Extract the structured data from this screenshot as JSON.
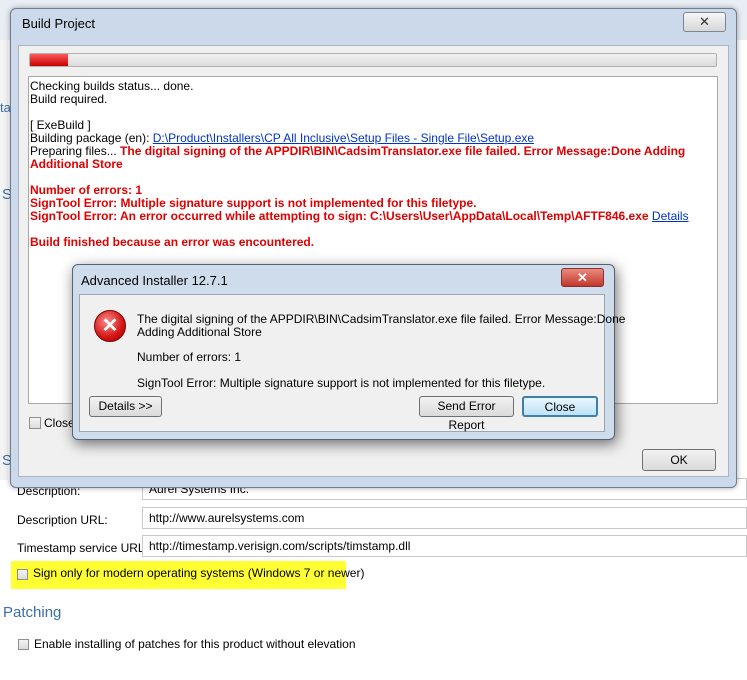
{
  "background_app": {
    "section_letters": [
      "ta",
      "S",
      "S"
    ],
    "description_label": "Description:",
    "description_value": "Aurel Systems Inc.",
    "description_url_label": "Description URL:",
    "description_url_value": "http://www.aurelsystems.com",
    "timestamp_label": "Timestamp service URL:",
    "timestamp_value": "http://timestamp.verisign.com/scripts/timstamp.dll",
    "sign_modern_label": "Sign only for modern operating systems (Windows 7 or newer)",
    "patching_title": "Patching",
    "patch_checkbox_label": "Enable installing of patches for this product without elevation"
  },
  "build_window": {
    "title": "Build Project",
    "close_glyph": "✕",
    "progress_fraction": 0.055,
    "log": {
      "line1": "Checking builds status... done.",
      "line2": "Build required.",
      "line3": "[ ExeBuild ]",
      "line4_prefix": "Building package (en): ",
      "line4_link": "D:\\Product\\Installers\\CP All Inclusive\\Setup Files - Single File\\Setup.exe",
      "line5_prefix": "Preparing files... ",
      "line5_error": "The digital signing of the APPDIR\\BIN\\CadsimTranslator.exe file failed. Error Message:Done Adding",
      "line6_error": "Additional Store",
      "line7_error": "Number of errors: 1",
      "line8_error": "SignTool Error: Multiple signature support is not implemented for this filetype.",
      "line9_error": "SignTool Error: An error occurred while attempting to sign: C:\\Users\\User\\AppData\\Local\\Temp\\AFTF846.exe",
      "line9_link": "Details",
      "line10_error": "Build finished because an error was encountered."
    },
    "close_checkbox_label": "Close",
    "ok_label": "OK"
  },
  "dialog": {
    "title": "Advanced Installer 12.7.1",
    "close_glyph": "✕",
    "icon_glyph": "✕",
    "message_line1": "The digital signing of the APPDIR\\BIN\\CadsimTranslator.exe file failed. Error Message:Done",
    "message_line2": "Adding Additional Store",
    "errors_count": "Number of errors: 1",
    "signtool_error": "SignTool Error: Multiple signature support is not implemented for this filetype.",
    "details_label": "Details >>",
    "send_report_label": "Send Error Report",
    "close_label": "Close"
  }
}
